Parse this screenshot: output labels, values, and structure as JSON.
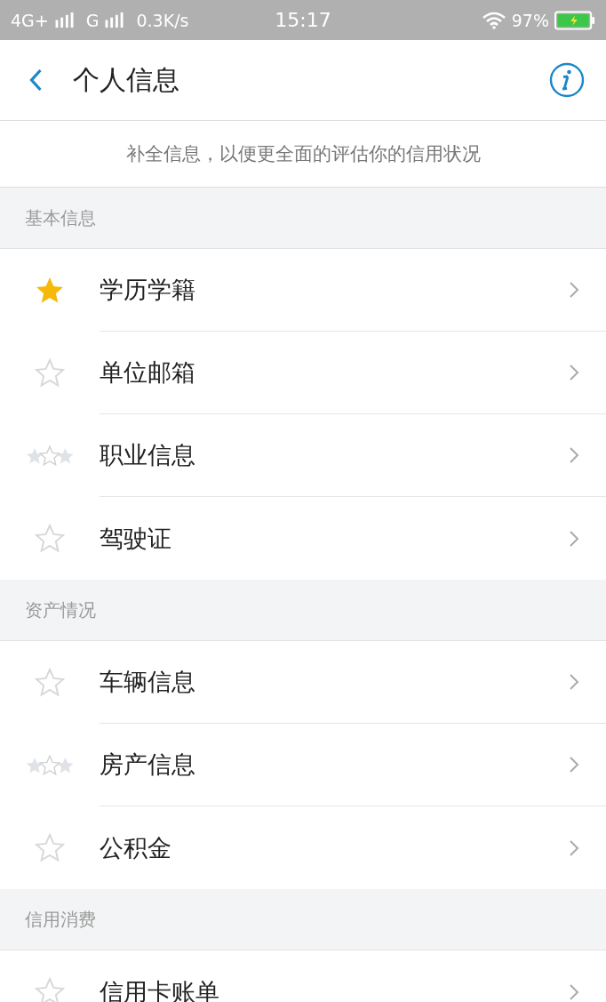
{
  "status_bar": {
    "network_1": "4G+",
    "network_2": "G",
    "speed": "0.3K/s",
    "time": "15:17",
    "battery": "97%",
    "charging": true
  },
  "header": {
    "title": "个人信息"
  },
  "notice": "补全信息，以便更全面的评估你的信用状况",
  "sections": [
    {
      "title": "基本信息",
      "items": [
        {
          "label": "学历学籍",
          "kind": "filled"
        },
        {
          "label": "单位邮箱",
          "kind": "outline"
        },
        {
          "label": "职业信息",
          "kind": "triple"
        },
        {
          "label": "驾驶证",
          "kind": "outline"
        }
      ]
    },
    {
      "title": "资产情况",
      "items": [
        {
          "label": "车辆信息",
          "kind": "outline"
        },
        {
          "label": "房产信息",
          "kind": "triple"
        },
        {
          "label": "公积金",
          "kind": "outline"
        }
      ]
    },
    {
      "title": "信用消费",
      "items": [
        {
          "label": "信用卡账单",
          "kind": "outline"
        }
      ]
    }
  ]
}
